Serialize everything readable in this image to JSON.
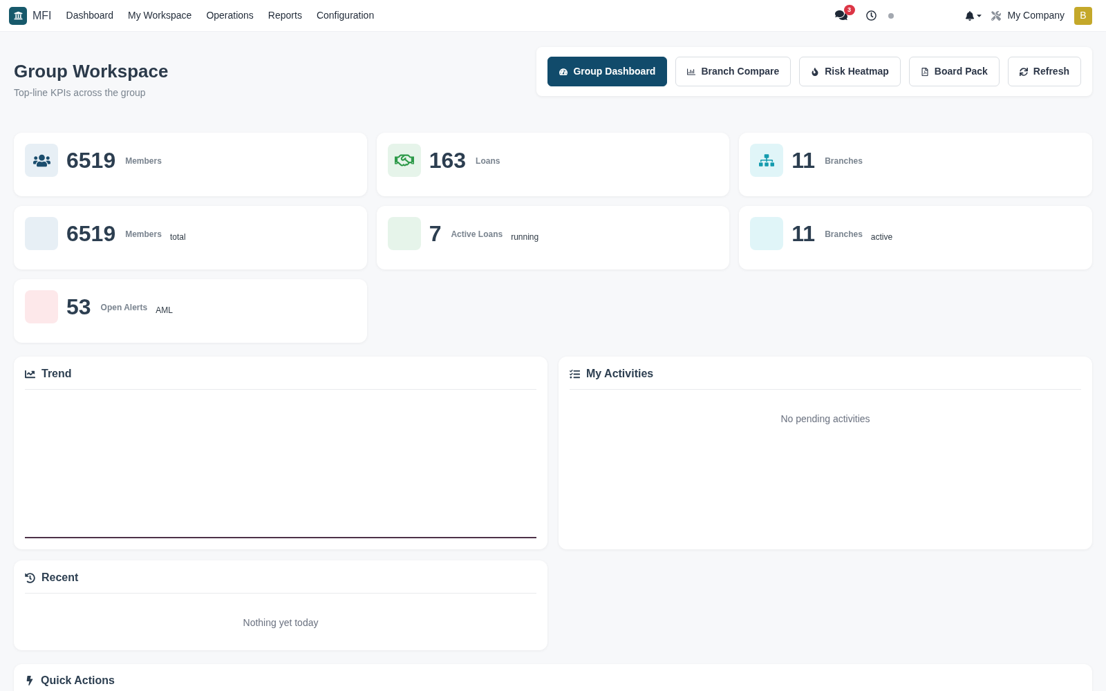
{
  "navbar": {
    "brand": "MFI",
    "menu": [
      {
        "label": "Dashboard"
      },
      {
        "label": "My Workspace"
      },
      {
        "label": "Operations"
      },
      {
        "label": "Reports"
      },
      {
        "label": "Configuration"
      }
    ],
    "messages_badge": "3",
    "company": "My Company",
    "avatar_initial": "B"
  },
  "header": {
    "title": "Group Workspace",
    "subtitle": "Top-line KPIs across the group",
    "actions": [
      {
        "label": "Group Dashboard",
        "selected": true
      },
      {
        "label": "Branch Compare",
        "selected": false
      },
      {
        "label": "Risk Heatmap",
        "selected": false
      },
      {
        "label": "Board Pack",
        "selected": false
      },
      {
        "label": "Refresh",
        "selected": false
      }
    ]
  },
  "kpi_cards": [
    {
      "kind": "members",
      "icon_shown": true,
      "value": "6519",
      "label": "Members"
    },
    {
      "kind": "loans",
      "icon_shown": true,
      "value": "163",
      "label": "Loans"
    },
    {
      "kind": "branches",
      "icon_shown": true,
      "value": "11",
      "label": "Branches"
    },
    {
      "kind": "members",
      "icon_shown": false,
      "value": "6519",
      "label": "Members",
      "note": "total"
    },
    {
      "kind": "loans",
      "icon_shown": false,
      "value": "7",
      "label": "Active Loans",
      "note": "running"
    },
    {
      "kind": "branches",
      "icon_shown": false,
      "value": "11",
      "label": "Branches",
      "note": "active"
    },
    {
      "kind": "alerts",
      "icon_shown": false,
      "value": "53",
      "label": "Open Alerts",
      "note": "AML"
    }
  ],
  "trend": {
    "title": "Trend"
  },
  "activities": {
    "title": "My Activities",
    "empty_message": "No pending activities"
  },
  "recent": {
    "title": "Recent",
    "empty_message": "Nothing yet today"
  },
  "quick_actions": {
    "title": "Quick Actions"
  }
}
